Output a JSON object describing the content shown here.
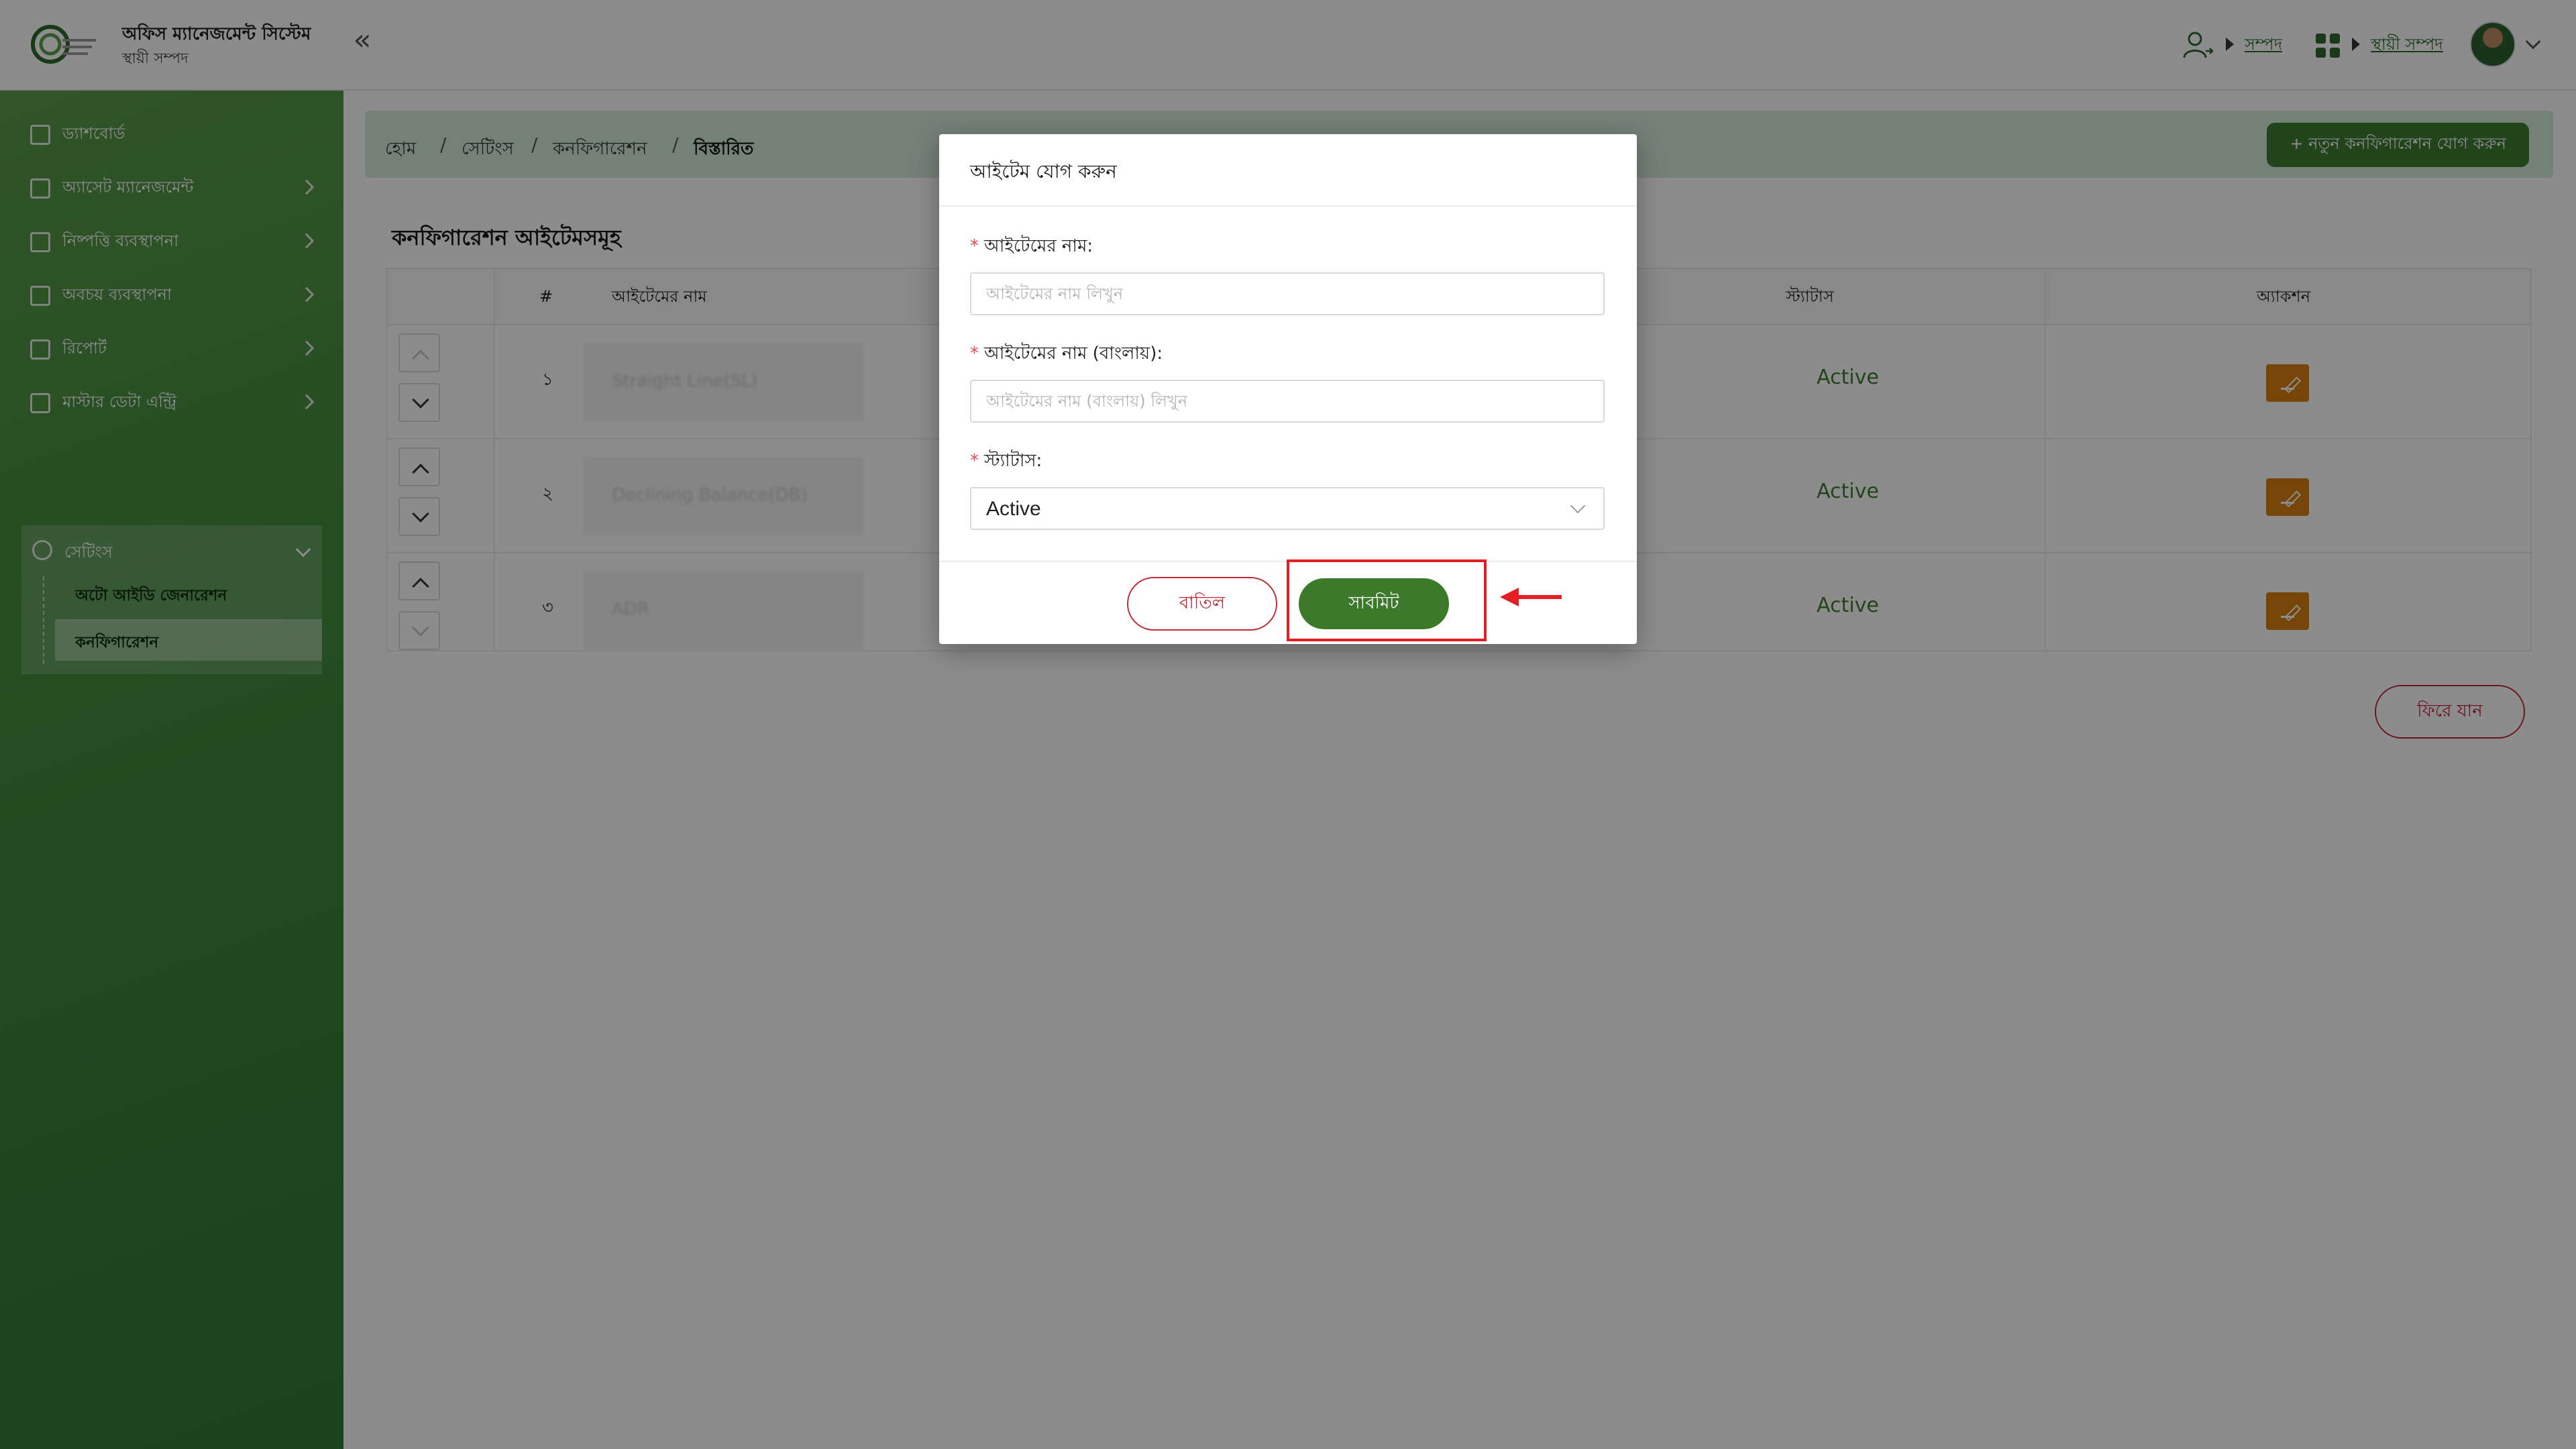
{
  "header": {
    "app_title": "অফিস ম্যানেজমেন্ট সিস্টেম",
    "app_subtitle": "স্থায়ী সম্পদ",
    "collapse_icon": "«",
    "crumb_asset": "সম্পদ",
    "crumb_fixed_asset": "স্থায়ী সম্পদ"
  },
  "sidebar": {
    "items": [
      {
        "label": "ড্যাশবোর্ড"
      },
      {
        "label": "অ্যাসেট ম্যানেজমেন্ট"
      },
      {
        "label": "নিষ্পত্তি ব্যবস্থাপনা"
      },
      {
        "label": "অবচয় ব্যবস্থাপনা"
      },
      {
        "label": "রিপোর্ট"
      },
      {
        "label": "মাস্টার ডেটা এন্ট্রি"
      }
    ],
    "settings": {
      "label": "সেটিংস",
      "sub_items": [
        {
          "label": "অটো আইডি জেনারেশন"
        },
        {
          "label": "কনফিগারেশন"
        }
      ]
    }
  },
  "breadcrumb": {
    "home": "হোম",
    "settings": "সেটিংস",
    "configuration": "কনফিগারেশন",
    "details": "বিস্তারিত",
    "separator": "/"
  },
  "add_config_button": "+ নতুন কনফিগারেশন যোগ করুন",
  "card": {
    "title": "কনফিগারেশন আইটেমসমূহ",
    "columns": {
      "num": "#",
      "item_name": "আইটেমের নাম",
      "status": "স্ট্যাটাস",
      "action": "অ্যাকশন"
    },
    "rows": [
      {
        "num": "১",
        "name": "Straight Line(SL)",
        "status": "Active"
      },
      {
        "num": "২",
        "name": "Declining Balance(DB)",
        "status": "Active"
      },
      {
        "num": "৩",
        "name": "ADR",
        "status": "Active"
      }
    ],
    "back_button": "ফিরে যান"
  },
  "modal": {
    "title": "আইটেম যোগ করুন",
    "required_mark": "*",
    "name_label": "আইটেমের নাম:",
    "name_placeholder": "আইটেমের নাম লিখুন",
    "name_bn_label": "আইটেমের নাম (বাংলায়):",
    "name_bn_placeholder": "আইটেমের নাম (বাংলায়) লিখুন",
    "status_label": "স্ট্যাটাস:",
    "status_value": "Active",
    "cancel_button": "বাতিল",
    "submit_button": "সাবমিট"
  },
  "colors": {
    "brand_green": "#3d7d32",
    "sidebar_green": "#3f8a3c",
    "breadcrumb_bg": "#d3ecd9",
    "edit_orange": "#d5800f",
    "danger_red": "#c22a3a",
    "highlight_red": "#e31e24"
  },
  "icons": {
    "collapse": "double-chevron-left-icon",
    "user_switch": "user-switch-icon",
    "apps": "apps-grid-icon",
    "edit": "pencil-icon",
    "move_up": "chevron-up-icon",
    "move_down": "chevron-down-icon",
    "annotation_arrow": "red-arrow-left-icon"
  }
}
